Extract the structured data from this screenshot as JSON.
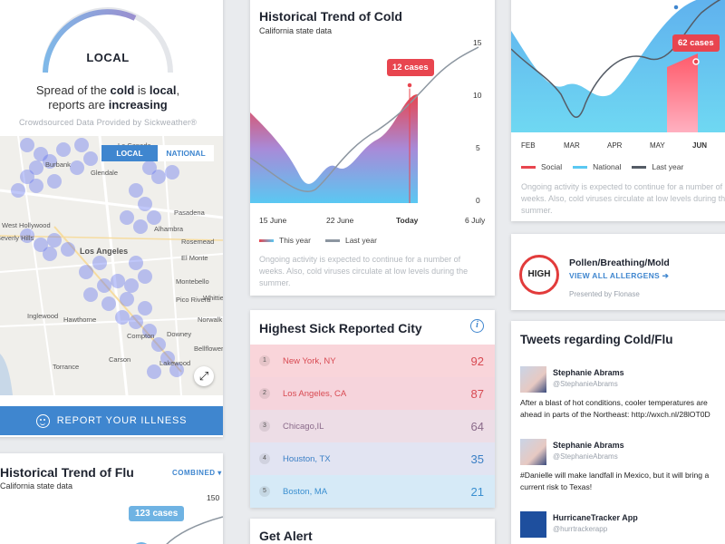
{
  "spread": {
    "level": "LOCAL",
    "line1_prefix": "Spread of the ",
    "line1_bold1": "cold",
    "line1_mid": " is ",
    "line1_bold2": "local",
    "line1_end": ",",
    "line2_prefix": "reports are ",
    "line2_bold": "increasing",
    "credit": "Crowdsourced Data Provided by Sickweather®",
    "toggle_local": "LOCAL",
    "toggle_national": "NATIONAL",
    "map_labels": [
      "La Canada",
      "Burbank",
      "Glendale",
      "West Hollywood",
      "Beverly Hills",
      "Los Angeles",
      "Alhambra",
      "Pasadena",
      "Rosemead",
      "El Monte",
      "Montebello",
      "Pico Rivera",
      "Inglewood",
      "Downey",
      "Hawthorne",
      "Compton",
      "Bellflower",
      "Carson",
      "Torrance",
      "Norwalk",
      "Lakewood",
      "Whittier"
    ],
    "report_button": "REPORT YOUR ILLNESS"
  },
  "flu": {
    "title": "Historical Trend of Flu",
    "subtitle": "California state data",
    "filter": "COMBINED",
    "axis_max": "150",
    "bubble": "123 cases"
  },
  "cold": {
    "title": "Historical Trend of Cold",
    "subtitle": "California state data",
    "y_ticks": [
      "15",
      "10",
      "5",
      "0"
    ],
    "x_ticks": [
      "15 June",
      "22 June",
      "Today",
      "6 July"
    ],
    "bubble": "12 cases",
    "legend_this_year": "This year",
    "legend_last_year": "Last year",
    "note": "Ongoing activity is expected to continue for a number of weeks. Also, cold viruses circulate at low levels during the summer."
  },
  "city": {
    "title": "Highest Sick Reported City",
    "rows": [
      {
        "rank": "1",
        "name": "New York, NY",
        "value": "92"
      },
      {
        "rank": "2",
        "name": "Los Angeles, CA",
        "value": "87"
      },
      {
        "rank": "3",
        "name": "Chicago,IL",
        "value": "64"
      },
      {
        "rank": "4",
        "name": "Houston, TX",
        "value": "35"
      },
      {
        "rank": "5",
        "name": "Boston, MA",
        "value": "21"
      }
    ],
    "colors": {
      "row_bg": [
        "#f9d5da",
        "#f6d4dc",
        "#eddde6",
        "#e2e4f2",
        "#d6eaf7"
      ],
      "text": [
        "#d84a52",
        "#d84a52",
        "#8a6a8a",
        "#3a7fc5",
        "#3a8fd0"
      ]
    }
  },
  "alert": {
    "title": "Get Alert"
  },
  "right_chart": {
    "x_ticks": [
      "FEB",
      "MAR",
      "APR",
      "MAY",
      "JUN"
    ],
    "bubble": "62 cases",
    "legend_social": "Social",
    "legend_national": "National",
    "legend_last_year": "Last year",
    "note": "Ongoing activity is expected to continue for a number of weeks. Also, cold viruses circulate at low levels during the summer."
  },
  "pollen": {
    "level": "HIGH",
    "title": "Pollen/Breathing/Mold",
    "link": "VIEW ALL ALLERGENS",
    "presented": "Presented by Flonase"
  },
  "tweets": {
    "title": "Tweets regarding Cold/Flu",
    "items": [
      {
        "name": "Stephanie Abrams",
        "handle": "@StephanieAbrams",
        "text": "After a blast of hot conditions, cooler temperatures are ahead in parts of the Northeast: http://wxch.nl/28lOT0D"
      },
      {
        "name": "Stephanie Abrams",
        "handle": "@StephanieAbrams",
        "text": "#Danielle will make landfall in Mexico, but it will bring a current risk to Texas!"
      },
      {
        "name": "HurricaneTracker App",
        "handle": "@hurrtrackerapp",
        "text": ""
      }
    ]
  },
  "theme": {
    "accent": "#3f86cf",
    "alert_red": "#e8454f",
    "light_blue": "#4fc3f0"
  }
}
